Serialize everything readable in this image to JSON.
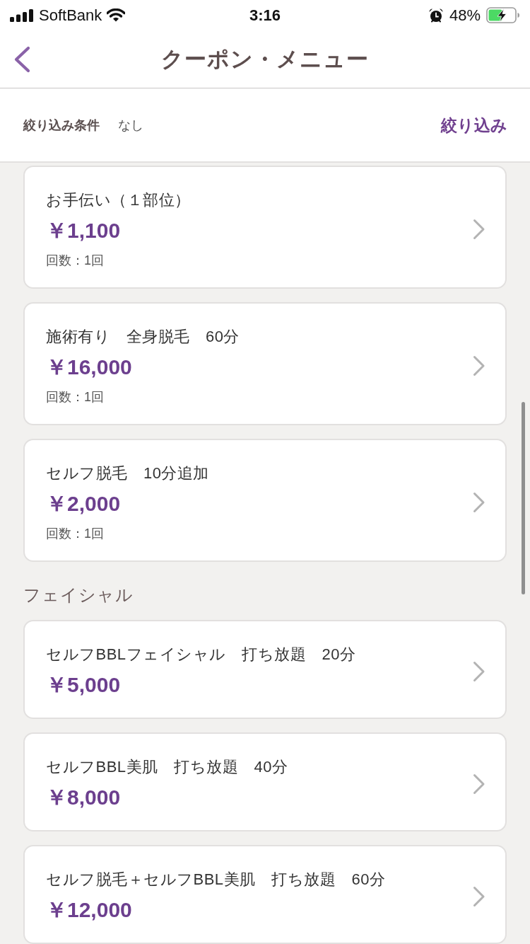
{
  "status_bar": {
    "carrier": "SoftBank",
    "time": "3:16",
    "battery": "48%"
  },
  "nav": {
    "title": "クーポン・メニュー"
  },
  "filter": {
    "label": "絞り込み条件",
    "value": "なし",
    "button": "絞り込み"
  },
  "sections": [
    {
      "items": [
        {
          "name": "お手伝い（１部位）",
          "price": "￥1,100",
          "count": "回数：1回"
        },
        {
          "name": "施術有り　全身脱毛　60分",
          "price": "￥16,000",
          "count": "回数：1回"
        },
        {
          "name": "セルフ脱毛　10分追加",
          "price": "￥2,000",
          "count": "回数：1回"
        }
      ]
    },
    {
      "heading": "フェイシャル",
      "items": [
        {
          "name": "セルフBBLフェイシャル　打ち放題　20分",
          "price": "￥5,000"
        },
        {
          "name": "セルフBBL美肌　打ち放題　40分",
          "price": "￥8,000"
        },
        {
          "name": "セルフ脱毛＋セルフBBL美肌　打ち放題　60分",
          "price": "￥12,000"
        }
      ]
    }
  ]
}
